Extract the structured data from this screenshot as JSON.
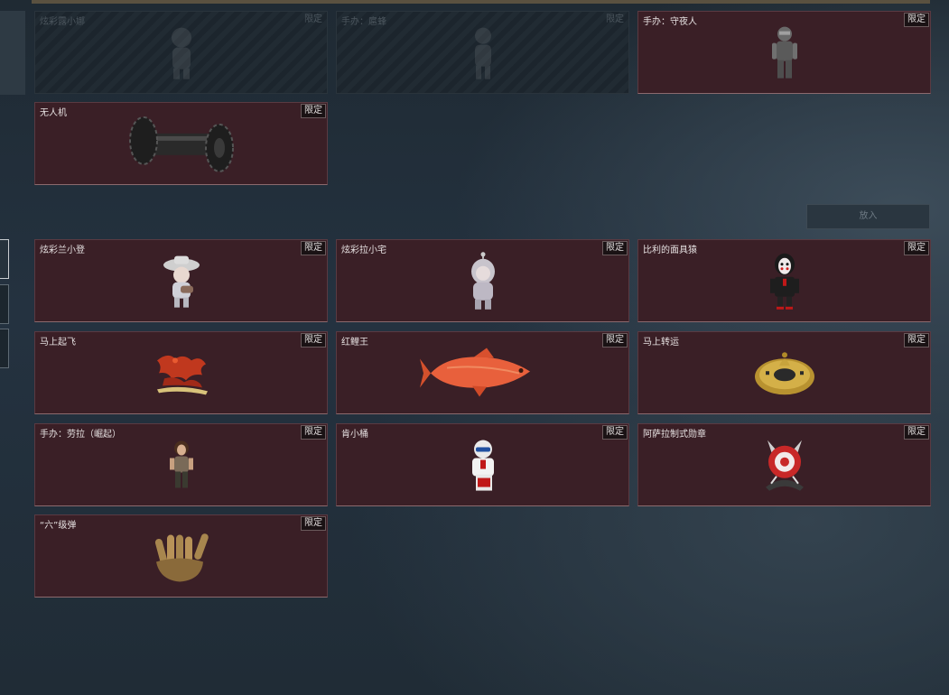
{
  "tag_label": "限定",
  "place_button_label": "放入",
  "top_slots": [
    {
      "name": "炫彩露小娜",
      "locked": true,
      "icon": "figure-icon"
    },
    {
      "name": "手办：扈蜂",
      "locked": true,
      "icon": "figure-icon"
    },
    {
      "name": "手办：守夜人",
      "locked": false,
      "icon": "armored-figure-icon"
    },
    {
      "name": "无人机",
      "locked": false,
      "icon": "drone-roller-icon"
    }
  ],
  "items": [
    {
      "name": "炫彩兰小登",
      "icon": "sombrero-figure-icon"
    },
    {
      "name": "炫彩拉小宅",
      "icon": "hooded-figure-icon"
    },
    {
      "name": "比利的面具猿",
      "icon": "puppet-figure-icon"
    },
    {
      "name": "马上起飞",
      "icon": "flying-horse-icon"
    },
    {
      "name": "红鲤王",
      "icon": "red-carp-icon"
    },
    {
      "name": "马上转运",
      "icon": "gold-medallion-icon"
    },
    {
      "name": "手办：劳拉（崛起）",
      "icon": "explorer-figure-icon"
    },
    {
      "name": "肯小桶",
      "icon": "colonel-figure-icon"
    },
    {
      "name": "阿萨拉制式勋章",
      "icon": "medal-icon"
    },
    {
      "name": "“六”级弹",
      "icon": "bullet-hand-icon"
    }
  ],
  "colors": {
    "slot_bg": "#3a1f26",
    "accent_tag_bg": "#1a1214"
  }
}
